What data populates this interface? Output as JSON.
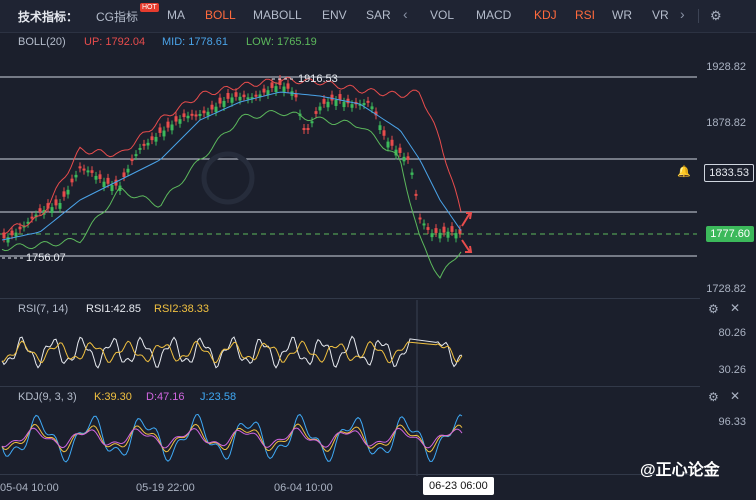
{
  "toolbar": {
    "title": "技术指标：",
    "items": [
      "CG指标",
      "MA",
      "BOLL",
      "MABOLL",
      "ENV",
      "SAR",
      "VOL",
      "MACD",
      "KDJ",
      "RSI",
      "WR",
      "VR"
    ],
    "hot_badge": "HOT",
    "active": "BOLL"
  },
  "boll": {
    "name": "BOLL(20)",
    "up": "UP: 1792.04",
    "mid": "MID: 1778.61",
    "low": "LOW: 1765.19",
    "colors": {
      "up": "#e74c4c",
      "mid": "#4aa3e8",
      "low": "#5cb85c"
    },
    "price_axis": [
      "1928.82",
      "1878.82",
      "1828.82",
      "1778.82",
      "1728.82"
    ],
    "high_label": "1916.53",
    "low_label": "1756.07",
    "current_price": "1777.60",
    "alert_price": "1833.53"
  },
  "rsi": {
    "name": "RSI(7, 14)",
    "rsi1": "RSI1:42.85",
    "rsi2": "RSI2:38.33",
    "axis": [
      "80.26",
      "30.26"
    ]
  },
  "kdj": {
    "name": "KDJ(9, 3, 3)",
    "k": "K:39.30",
    "d": "D:47.16",
    "j": "J:23.58",
    "axis": [
      "96.33"
    ]
  },
  "dates": [
    "05-04 10:00",
    "05-19 22:00",
    "06-04 10:00"
  ],
  "crosshair_date": "06-23 06:00",
  "watermark": "@正心论金"
}
